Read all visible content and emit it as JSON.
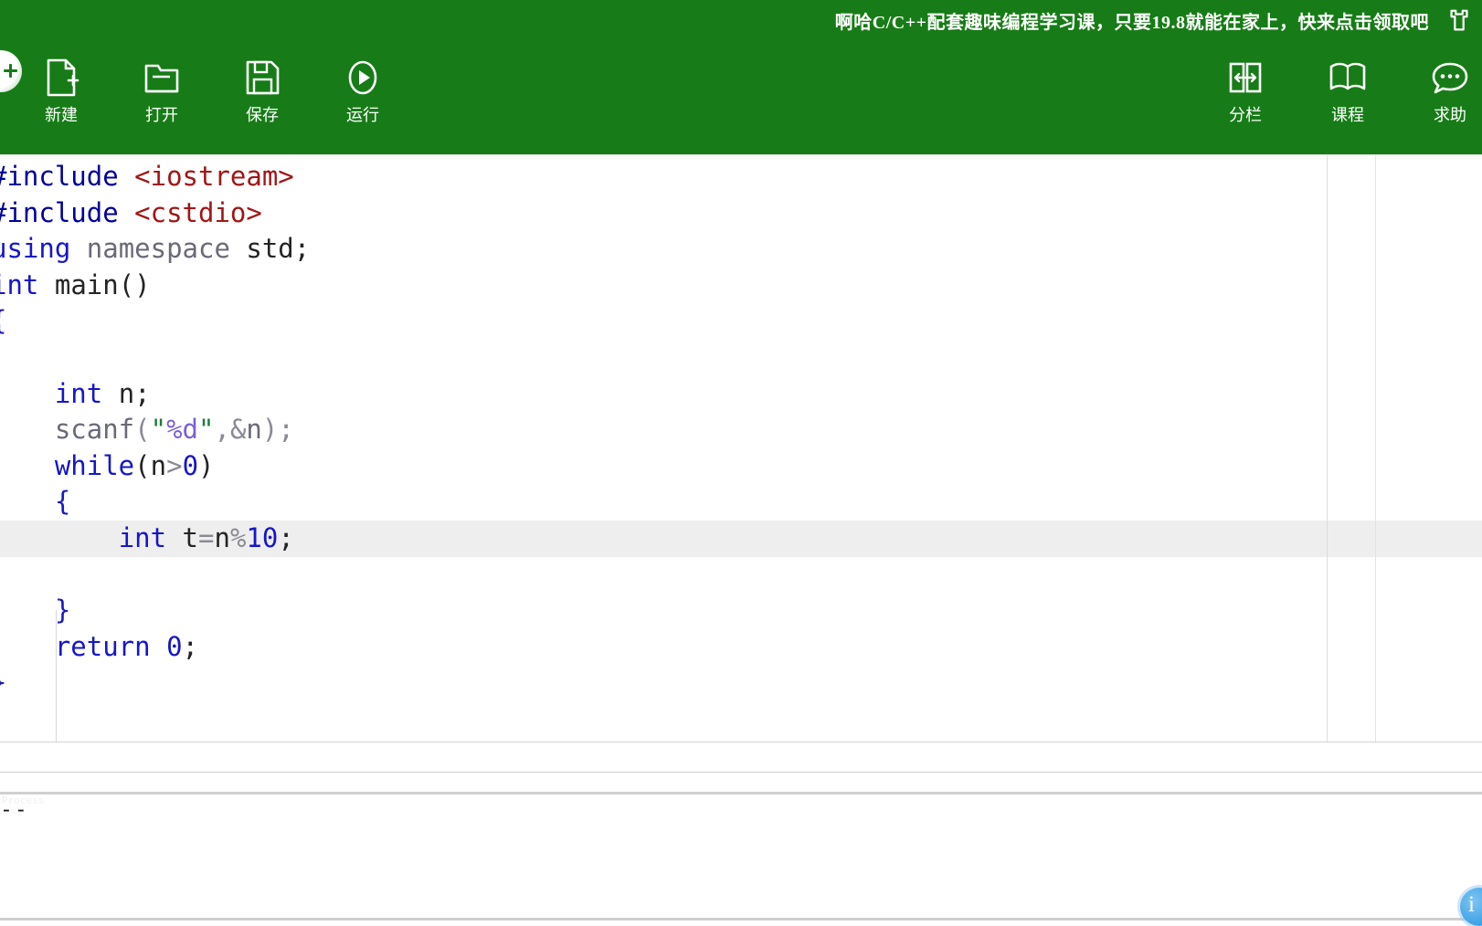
{
  "app": {
    "accent_green": "#177c17",
    "highlight_color": "#ececec"
  },
  "toolbar": {
    "banner_text": "啊哈C/C++配套趣味编程学习课，只要19.8就能在家上，快来点击领取吧",
    "banner_icon": "gift-shirt-icon",
    "left_buttons": [
      {
        "label": "新建",
        "icon": "new-file-icon"
      },
      {
        "label": "打开",
        "icon": "open-folder-icon"
      },
      {
        "label": "保存",
        "icon": "save-floppy-icon"
      },
      {
        "label": "运行",
        "icon": "run-play-icon"
      }
    ],
    "right_buttons": [
      {
        "label": "分栏",
        "icon": "split-columns-icon"
      },
      {
        "label": "课程",
        "icon": "book-icon"
      },
      {
        "label": "求助",
        "icon": "help-chat-icon"
      }
    ]
  },
  "left_fab": {
    "icon": "plus-circle-icon"
  },
  "bottom_fab": {
    "icon": "info-circle-icon",
    "glyph": "i"
  },
  "editor": {
    "language": "cpp",
    "current_line_index": 10,
    "lines": [
      {
        "tokens": [
          {
            "t": "#include",
            "c": "t-pre"
          },
          {
            "t": " ",
            "c": "t-plain"
          },
          {
            "t": "<iostream>",
            "c": "t-hdr"
          }
        ]
      },
      {
        "tokens": [
          {
            "t": "#include",
            "c": "t-pre"
          },
          {
            "t": " ",
            "c": "t-plain"
          },
          {
            "t": "<cstdio>",
            "c": "t-hdr"
          }
        ]
      },
      {
        "tokens": [
          {
            "t": "using",
            "c": "t-kw"
          },
          {
            "t": " namespace ",
            "c": "t-plain"
          },
          {
            "t": "std",
            "c": "t-dark"
          },
          {
            "t": ";",
            "c": "t-dark"
          }
        ]
      },
      {
        "tokens": [
          {
            "t": "int",
            "c": "t-kw"
          },
          {
            "t": " ",
            "c": "t-plain"
          },
          {
            "t": "main",
            "c": "t-dark"
          },
          {
            "t": "()",
            "c": "t-dark"
          }
        ]
      },
      {
        "tokens": [
          {
            "t": "{",
            "c": "t-brace"
          }
        ]
      },
      {
        "tokens": [
          {
            "t": "",
            "c": "t-plain"
          }
        ]
      },
      {
        "tokens": [
          {
            "t": "    ",
            "c": "t-plain"
          },
          {
            "t": "int",
            "c": "t-kw"
          },
          {
            "t": " ",
            "c": "t-plain"
          },
          {
            "t": "n",
            "c": "t-dark"
          },
          {
            "t": ";",
            "c": "t-dark"
          }
        ]
      },
      {
        "tokens": [
          {
            "t": "    ",
            "c": "t-plain"
          },
          {
            "t": "scanf",
            "c": "t-id"
          },
          {
            "t": "(",
            "c": "t-op"
          },
          {
            "t": "\"",
            "c": "t-str"
          },
          {
            "t": "%d",
            "c": "t-fmt"
          },
          {
            "t": "\"",
            "c": "t-str"
          },
          {
            "t": ",",
            "c": "t-op"
          },
          {
            "t": "&",
            "c": "t-op"
          },
          {
            "t": "n",
            "c": "t-id"
          },
          {
            "t": ")",
            "c": "t-op"
          },
          {
            "t": ";",
            "c": "t-op"
          }
        ]
      },
      {
        "tokens": [
          {
            "t": "    ",
            "c": "t-plain"
          },
          {
            "t": "while",
            "c": "t-kw"
          },
          {
            "t": "(",
            "c": "t-dark"
          },
          {
            "t": "n",
            "c": "t-dark"
          },
          {
            "t": ">",
            "c": "t-op"
          },
          {
            "t": "0",
            "c": "t-num"
          },
          {
            "t": ")",
            "c": "t-dark"
          }
        ]
      },
      {
        "tokens": [
          {
            "t": "    ",
            "c": "t-plain"
          },
          {
            "t": "{",
            "c": "t-brace"
          }
        ]
      },
      {
        "tokens": [
          {
            "t": "        ",
            "c": "t-plain"
          },
          {
            "t": "int",
            "c": "t-kw"
          },
          {
            "t": " ",
            "c": "t-plain"
          },
          {
            "t": "t",
            "c": "t-dark"
          },
          {
            "t": "=",
            "c": "t-op"
          },
          {
            "t": "n",
            "c": "t-dark"
          },
          {
            "t": "%",
            "c": "t-op"
          },
          {
            "t": "10",
            "c": "t-num"
          },
          {
            "t": ";",
            "c": "t-dark"
          }
        ]
      },
      {
        "tokens": [
          {
            "t": "        ",
            "c": "t-plain"
          }
        ]
      },
      {
        "tokens": [
          {
            "t": "    ",
            "c": "t-plain"
          },
          {
            "t": "}",
            "c": "t-brace"
          }
        ]
      },
      {
        "tokens": [
          {
            "t": "    ",
            "c": "t-plain"
          },
          {
            "t": "return",
            "c": "t-kw"
          },
          {
            "t": " ",
            "c": "t-plain"
          },
          {
            "t": "0",
            "c": "t-num"
          },
          {
            "t": ";",
            "c": "t-dark"
          }
        ]
      },
      {
        "tokens": [
          {
            "t": "}",
            "c": "t-brace"
          }
        ]
      }
    ]
  },
  "output": {
    "text": "--",
    "ghost_text": "Process"
  }
}
